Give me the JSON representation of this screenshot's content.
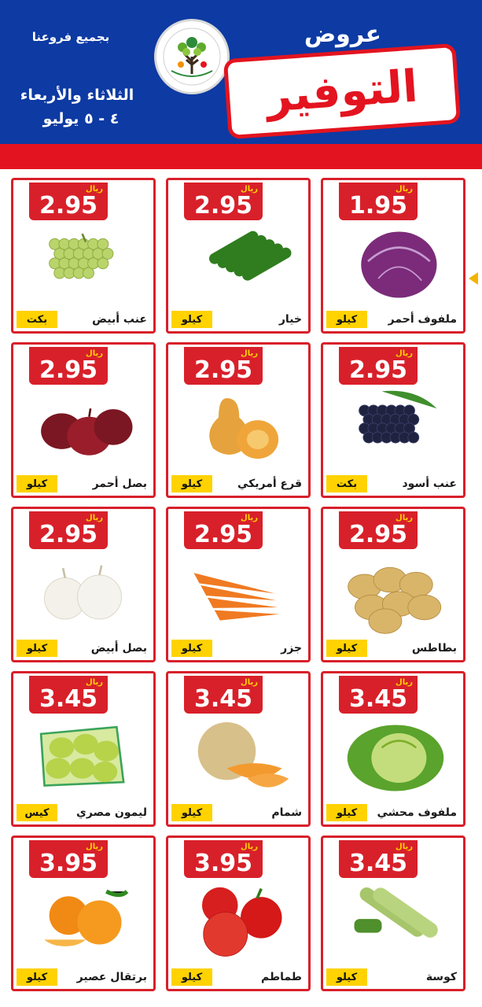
{
  "header": {
    "offers_word": "عروض",
    "savings_word": "التوفير",
    "branches": "بجميع فروعنا",
    "days": "الثلاثاء والأربعاء",
    "dates": "٤ - ٥ يوليو",
    "logo_icon": "tree-logo-icon",
    "brand_blue": "#0d3aa3",
    "brand_red": "#e3141f"
  },
  "products": [
    {
      "name": "عنب أبيض",
      "price": "2.95",
      "currency": "ريال",
      "unit": "بكت",
      "icon": "white-grapes-icon"
    },
    {
      "name": "خيار",
      "price": "2.95",
      "currency": "ريال",
      "unit": "كيلو",
      "icon": "cucumber-icon"
    },
    {
      "name": "ملفوف أحمر",
      "price": "1.95",
      "currency": "ريال",
      "unit": "كيلو",
      "icon": "red-cabbage-icon"
    },
    {
      "name": "بصل أحمر",
      "price": "2.95",
      "currency": "ريال",
      "unit": "كيلو",
      "icon": "red-onion-icon"
    },
    {
      "name": "قرع أمريكي",
      "price": "2.95",
      "currency": "ريال",
      "unit": "كيلو",
      "icon": "butternut-squash-icon"
    },
    {
      "name": "عنب أسود",
      "price": "2.95",
      "currency": "ريال",
      "unit": "بكت",
      "icon": "black-grapes-icon"
    },
    {
      "name": "بصل أبيض",
      "price": "2.95",
      "currency": "ريال",
      "unit": "كيلو",
      "icon": "white-onion-icon"
    },
    {
      "name": "جزر",
      "price": "2.95",
      "currency": "ريال",
      "unit": "كيلو",
      "icon": "carrot-icon"
    },
    {
      "name": "بطاطس",
      "price": "2.95",
      "currency": "ريال",
      "unit": "كيلو",
      "icon": "potato-icon"
    },
    {
      "name": "ليمون مصري",
      "price": "3.45",
      "currency": "ريال",
      "unit": "كيس",
      "icon": "lemon-bag-icon"
    },
    {
      "name": "شمام",
      "price": "3.45",
      "currency": "ريال",
      "unit": "كيلو",
      "icon": "cantaloupe-icon"
    },
    {
      "name": "ملفوف محشي",
      "price": "3.45",
      "currency": "ريال",
      "unit": "كيلو",
      "icon": "green-cabbage-icon"
    },
    {
      "name": "برتقال عصير",
      "price": "3.95",
      "currency": "ريال",
      "unit": "كيلو",
      "icon": "orange-icon"
    },
    {
      "name": "طماطم",
      "price": "3.95",
      "currency": "ريال",
      "unit": "كيلو",
      "icon": "tomato-icon"
    },
    {
      "name": "كوسة",
      "price": "3.45",
      "currency": "ريال",
      "unit": "كيلو",
      "icon": "zucchini-icon"
    }
  ],
  "colors": {
    "card_border": "#d8202a",
    "price_bg": "#d8202a",
    "unit_bg": "#ffd200"
  }
}
